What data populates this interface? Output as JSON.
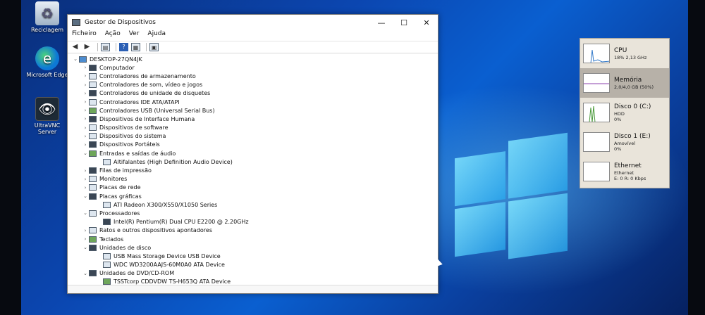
{
  "desktop": {
    "icons": [
      {
        "label": "Reciclagem",
        "icon": "recycle-bin-icon"
      },
      {
        "label": "Microsoft Edge",
        "icon": "edge-icon"
      },
      {
        "label": "UltraVNC Server",
        "icon": "ultravnc-icon"
      }
    ]
  },
  "device_manager": {
    "title": "Gestor de Dispositivos",
    "menu": [
      "Ficheiro",
      "Ação",
      "Ver",
      "Ajuda"
    ],
    "root": "DESKTOP-27QN4JK",
    "tree": [
      {
        "label": "Computador",
        "level": 1,
        "expanded": false
      },
      {
        "label": "Controladores de armazenamento",
        "level": 1,
        "expanded": false
      },
      {
        "label": "Controladores de som, vídeo e jogos",
        "level": 1,
        "expanded": false
      },
      {
        "label": "Controladores de unidade de disquetes",
        "level": 1,
        "expanded": false
      },
      {
        "label": "Controladores IDE ATA/ATAPI",
        "level": 1,
        "expanded": false
      },
      {
        "label": "Controladores USB (Universal Serial Bus)",
        "level": 1,
        "expanded": false
      },
      {
        "label": "Dispositivos de Interface Humana",
        "level": 1,
        "expanded": false
      },
      {
        "label": "Dispositivos de software",
        "level": 1,
        "expanded": false
      },
      {
        "label": "Dispositivos do sistema",
        "level": 1,
        "expanded": false
      },
      {
        "label": "Dispositivos Portáteis",
        "level": 1,
        "expanded": false
      },
      {
        "label": "Entradas e saídas de áudio",
        "level": 1,
        "expanded": true
      },
      {
        "label": "Altifalantes (High Definition Audio Device)",
        "level": 2
      },
      {
        "label": "Filas de impressão",
        "level": 1,
        "expanded": false
      },
      {
        "label": "Monitores",
        "level": 1,
        "expanded": false
      },
      {
        "label": "Placas de rede",
        "level": 1,
        "expanded": false
      },
      {
        "label": "Placas gráficas",
        "level": 1,
        "expanded": true
      },
      {
        "label": "ATI Radeon X300/X550/X1050 Series",
        "level": 2
      },
      {
        "label": "Processadores",
        "level": 1,
        "expanded": true
      },
      {
        "label": "Intel(R) Pentium(R) Dual  CPU  E2200  @ 2.20GHz",
        "level": 2
      },
      {
        "label": "Ratos e outros dispositivos apontadores",
        "level": 1,
        "expanded": false
      },
      {
        "label": "Teclados",
        "level": 1,
        "expanded": false
      },
      {
        "label": "Unidades de disco",
        "level": 1,
        "expanded": true
      },
      {
        "label": "USB Mass  Storage Device USB Device",
        "level": 2
      },
      {
        "label": "WDC WD3200AAJS-60M0A0 ATA Device",
        "level": 2
      },
      {
        "label": "Unidades de DVD/CD-ROM",
        "level": 1,
        "expanded": true
      },
      {
        "label": "TSSTcorp CDDVDW TS-H653Q ATA Device",
        "level": 2
      }
    ]
  },
  "task_manager": {
    "items": [
      {
        "name": "CPU",
        "sub1": "18% 2,13 GHz",
        "sub2": "",
        "selected": false
      },
      {
        "name": "Memória",
        "sub1": "2,0/4,0 GB (50%)",
        "sub2": "",
        "selected": true
      },
      {
        "name": "Disco 0 (C:)",
        "sub1": "HDD",
        "sub2": "0%",
        "selected": false
      },
      {
        "name": "Disco 1 (E:)",
        "sub1": "Amovível",
        "sub2": "0%",
        "selected": false
      },
      {
        "name": "Ethernet",
        "sub1": "Ethernet",
        "sub2": "E: 0 R: 0 Kbps",
        "selected": false
      }
    ]
  }
}
